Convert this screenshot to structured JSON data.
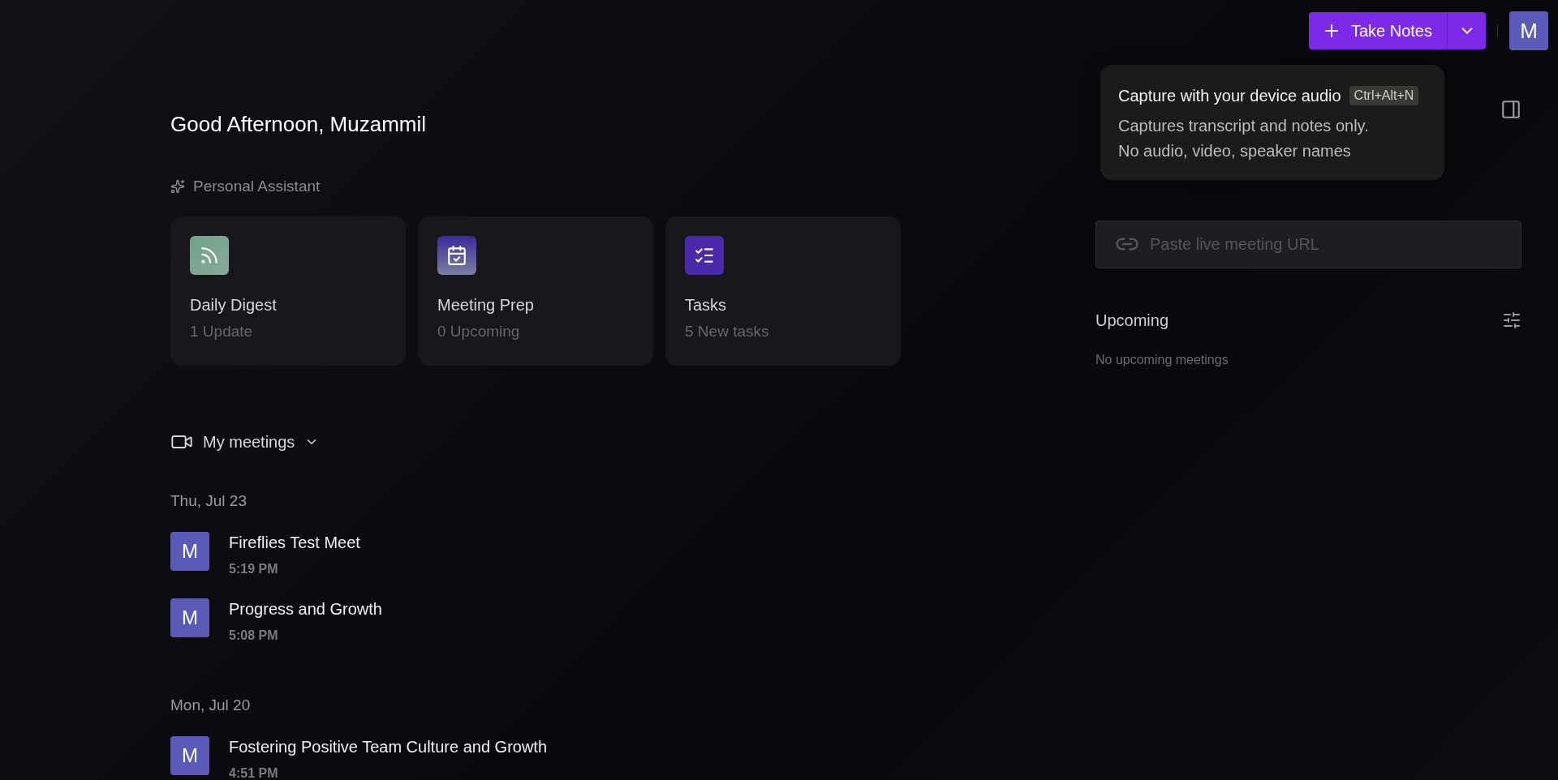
{
  "header": {
    "take_notes": {
      "label": "Take Notes"
    },
    "avatar": "M"
  },
  "tooltip": {
    "title": "Capture with your device audio",
    "shortcut": "Ctrl+Alt+N",
    "lines": [
      "Captures transcript and notes only.",
      "No audio, video, speaker names"
    ]
  },
  "greeting": "Good Afternoon, Muzammil",
  "assistant": {
    "title": "Personal Assistant",
    "cards": [
      {
        "kind": "digest",
        "title": "Daily Digest",
        "subtitle": "1 Update"
      },
      {
        "kind": "prep",
        "title": "Meeting Prep",
        "subtitle": "0 Upcoming"
      },
      {
        "kind": "tasks",
        "title": "Tasks",
        "subtitle": "5 New tasks"
      }
    ]
  },
  "meetings": {
    "title": "My meetings",
    "groups": [
      {
        "date": "Thu, Jul 23",
        "items": [
          {
            "avatar": "M",
            "title": "Fireflies Test Meet",
            "time": "5:19 PM"
          },
          {
            "avatar": "M",
            "title": "Progress and Growth",
            "time": "5:08 PM"
          }
        ]
      },
      {
        "date": "Mon, Jul 20",
        "items": [
          {
            "avatar": "M",
            "title": "Fostering Positive Team Culture and Growth",
            "time": "4:51 PM"
          }
        ]
      }
    ]
  },
  "live_meeting": {
    "placeholder": "Paste live meeting URL"
  },
  "upcoming": {
    "title": "Upcoming",
    "empty": "No upcoming meetings"
  }
}
